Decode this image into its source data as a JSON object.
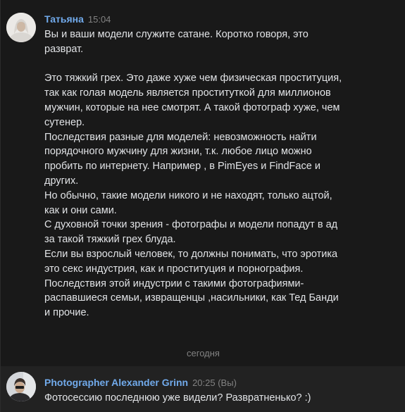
{
  "messages": [
    {
      "author": "Татьяна",
      "time": "15:04",
      "lines": [
        "Вы и ваши модели служите сатане. Коротко говоря, это",
        "разврат.",
        "",
        "Это тяжкий грех. Это даже хуже чем физическая проституция,",
        "так как голая модель является проституткой для миллионов",
        "мужчин, которые на нее смотрят. А такой фотограф хуже, чем",
        "сутенер.",
        "Последствия разные для моделей: невозможность найти",
        "порядочного мужчину для жизни, т.к. любое лицо можно",
        "пробить по интернету. Например , в PimEyes и FindFace и",
        "других.",
        "Но обычно, такие модели никого и не находят, только ацтой,",
        "как и они сами.",
        "С духовной точки зрения - фотографы и модели попадут в ад",
        "за такой тяжкий грех блуда.",
        "Если вы взрослый человек, то должны понимать, что эротика",
        "это секс индустрия, как и проституция и порнография.",
        "Последствия этой индустрии с такими фотографиями-",
        "распавшиеся семьи, извращенцы ,насильники, как Тед Банди",
        "и прочие."
      ]
    },
    {
      "author": "Photographer Alexander Grinn",
      "time": "20:25 (Вы)",
      "lines": [
        "Фотосессию последнюю уже видели? Развратненько? :)"
      ]
    }
  ],
  "divider": "сегодня",
  "colors": {
    "background": "#191919",
    "author": "#71aaeb",
    "text": "#e1e3e6",
    "muted": "#828282",
    "highlight_row": "#222222"
  }
}
